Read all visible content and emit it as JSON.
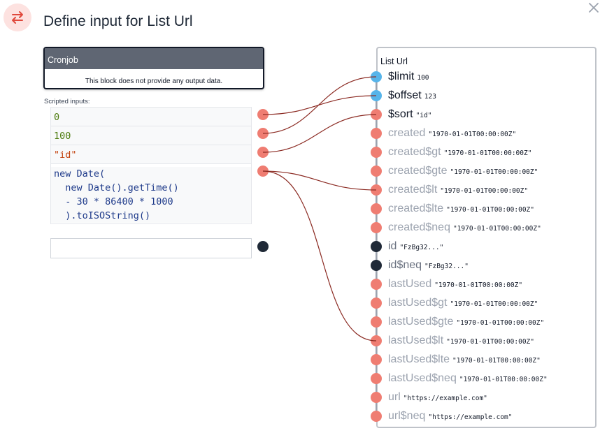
{
  "dialog": {
    "title": "Define input for List Url",
    "header_icon": "swap-arrows-icon",
    "close_icon": "close-icon"
  },
  "source": {
    "title": "Cronjob",
    "note": "This block does not provide any output data."
  },
  "scripted_inputs": {
    "label": "Scripted inputs:",
    "items": [
      {
        "code": "0"
      },
      {
        "code": "100"
      },
      {
        "code": "\"id\""
      },
      {
        "code": "new Date(\n  new Date().getTime()\n  - 30 * 86400 * 1000\n  ).toISOString()"
      }
    ],
    "empty_placeholder": ""
  },
  "target": {
    "title": "List Url",
    "params": [
      {
        "name": "$limit",
        "value": "100",
        "state": "connected",
        "handle": "blue"
      },
      {
        "name": "$offset",
        "value": "123",
        "state": "connected",
        "handle": "blue"
      },
      {
        "name": "$sort",
        "value": "\"id\"",
        "state": "connected",
        "handle": "red"
      },
      {
        "name": "created",
        "value": "\"1970-01-01T00:00:00Z\"",
        "state": "inactive",
        "handle": "red"
      },
      {
        "name": "created$gt",
        "value": "\"1970-01-01T00:00:00Z\"",
        "state": "inactive",
        "handle": "red"
      },
      {
        "name": "created$gte",
        "value": "\"1970-01-01T00:00:00Z\"",
        "state": "inactive",
        "handle": "red"
      },
      {
        "name": "created$lt",
        "value": "\"1970-01-01T00:00:00Z\"",
        "state": "inactive",
        "handle": "red"
      },
      {
        "name": "created$lte",
        "value": "\"1970-01-01T00:00:00Z\"",
        "state": "inactive",
        "handle": "red"
      },
      {
        "name": "created$neq",
        "value": "\"1970-01-01T00:00:00Z\"",
        "state": "inactive",
        "handle": "red"
      },
      {
        "name": "id",
        "value": "\"FzBg32...\"",
        "state": "mid",
        "handle": "dark"
      },
      {
        "name": "id$neq",
        "value": "\"FzBg32...\"",
        "state": "mid",
        "handle": "dark"
      },
      {
        "name": "lastUsed",
        "value": "\"1970-01-01T00:00:00Z\"",
        "state": "inactive",
        "handle": "red"
      },
      {
        "name": "lastUsed$gt",
        "value": "\"1970-01-01T00:00:00Z\"",
        "state": "inactive",
        "handle": "red"
      },
      {
        "name": "lastUsed$gte",
        "value": "\"1970-01-01T00:00:00Z\"",
        "state": "inactive",
        "handle": "red"
      },
      {
        "name": "lastUsed$lt",
        "value": "\"1970-01-01T00:00:00Z\"",
        "state": "inactive",
        "handle": "red"
      },
      {
        "name": "lastUsed$lte",
        "value": "\"1970-01-01T00:00:00Z\"",
        "state": "inactive",
        "handle": "red"
      },
      {
        "name": "lastUsed$neq",
        "value": "\"1970-01-01T00:00:00Z\"",
        "state": "inactive",
        "handle": "red"
      },
      {
        "name": "url",
        "value": "\"https://example.com\"",
        "state": "inactive",
        "handle": "red"
      },
      {
        "name": "url$neq",
        "value": "\"https://example.com\"",
        "state": "inactive",
        "handle": "red"
      }
    ]
  },
  "connections": [
    {
      "from_input": 0,
      "to_param": "$offset"
    },
    {
      "from_input": 1,
      "to_param": "$limit"
    },
    {
      "from_input": 2,
      "to_param": "$sort"
    },
    {
      "from_input": 3,
      "to_param": "created$lt"
    },
    {
      "from_input": 3,
      "to_param": "lastUsed$lt"
    }
  ],
  "colors": {
    "handle_red": "#ef7d72",
    "handle_blue": "#56b4ea",
    "handle_dark": "#1f2937",
    "wire": "#8b2a22",
    "header_bar": "#5f6673"
  }
}
